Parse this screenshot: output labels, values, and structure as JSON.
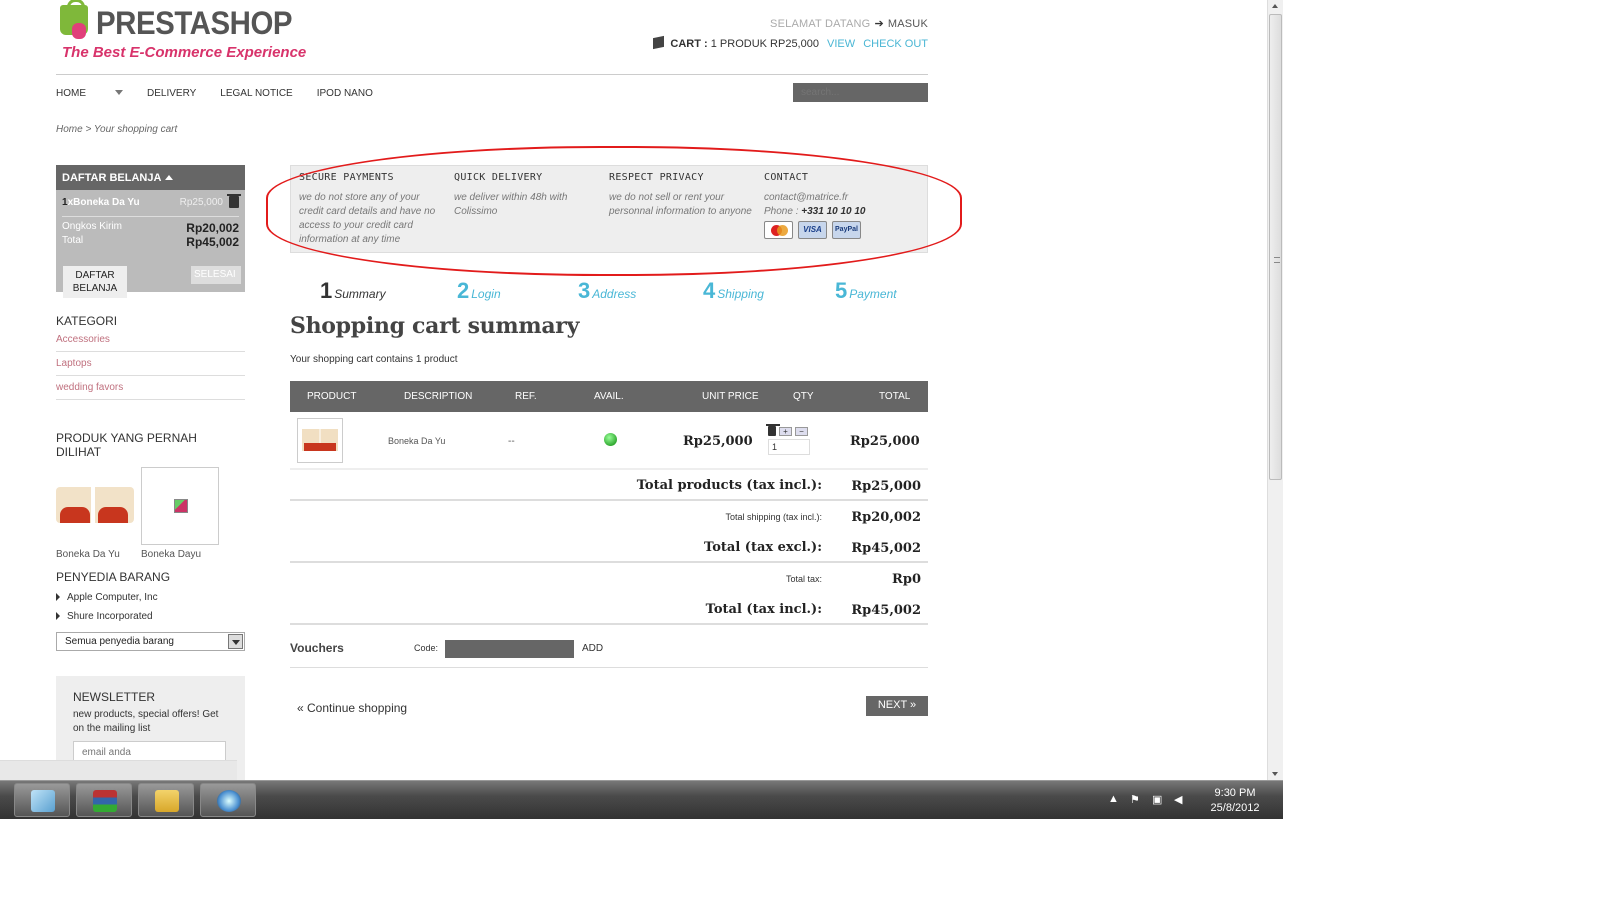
{
  "header": {
    "logo_name": "PRESTASHOP",
    "logo_tagline": "The Best E-Commerce Experience",
    "welcome": "SELAMAT DATANG",
    "login": "MASUK",
    "cart_label": "CART :",
    "cart_summary": "1 PRODUK RP25,000",
    "view": "VIEW",
    "checkout": "CHECK OUT"
  },
  "nav": {
    "items": [
      "HOME",
      "DELIVERY",
      "LEGAL NOTICE",
      "IPOD NANO"
    ],
    "search_placeholder": "search..."
  },
  "breadcrumb": "Home > Your shopping cart",
  "cart_block": {
    "title": "DAFTAR BELANJA",
    "item_qty": "1",
    "item_name": "xBoneka Da Yu",
    "item_price": "Rp25,000",
    "shipping_label": "Ongkos Kirim",
    "shipping_value": "Rp20,002",
    "total_label": "Total",
    "total_value": "Rp45,002",
    "btn_cart": "DAFTAR BELANJA",
    "btn_done": "SELESAI"
  },
  "categories": {
    "title": "KATEGORI",
    "items": [
      "Accessories",
      "Laptops",
      "wedding favors"
    ]
  },
  "viewed": {
    "title": "PRODUK YANG PERNAH DILIHAT",
    "items": [
      "Boneka Da Yu",
      "Boneka Dayu"
    ]
  },
  "suppliers": {
    "title": "PENYEDIA BARANG",
    "items": [
      "Apple Computer, Inc",
      "Shure Incorporated"
    ],
    "select_value": "Semua penyedia barang"
  },
  "newsletter": {
    "title": "NEWSLETTER",
    "desc": "new products, special offers! Get on the mailing list",
    "placeholder": "email anda"
  },
  "reassurance": [
    {
      "title": "SECURE PAYMENTS",
      "text": "we do not store any of your credit card details and have no access to your credit card information at any time"
    },
    {
      "title": "QUICK DELIVERY",
      "text": "we deliver within 48h with Colissimo"
    },
    {
      "title": "RESPECT PRIVACY",
      "text": "we do not sell or rent your personnal information to anyone"
    },
    {
      "title": "CONTACT",
      "email": "contact@matrice.fr",
      "phone_label": "Phone :",
      "phone": "+331 10 10 10",
      "cards": [
        "MC",
        "VISA",
        "PayPal"
      ]
    }
  ],
  "steps": [
    {
      "num": "1",
      "label": "Summary",
      "color": "#333333"
    },
    {
      "num": "2",
      "label": "Login",
      "color": "#49b7d6"
    },
    {
      "num": "3",
      "label": "Address",
      "color": "#49b7d6"
    },
    {
      "num": "4",
      "label": "Shipping",
      "color": "#49b7d6"
    },
    {
      "num": "5",
      "label": "Payment",
      "color": "#49b7d6"
    }
  ],
  "summary": {
    "title": "Shopping cart summary",
    "contains": "Your shopping cart contains 1 product",
    "columns": [
      "PRODUCT",
      "DESCRIPTION",
      "REF.",
      "AVAIL.",
      "UNIT PRICE",
      "QTY",
      "TOTAL"
    ],
    "row": {
      "description": "Boneka Da Yu",
      "ref": "--",
      "unit_price": "Rp25,000",
      "qty": "1",
      "total": "Rp25,000"
    },
    "totals": [
      {
        "label": "Total products (tax incl.):",
        "value": "Rp25,000"
      },
      {
        "label": "Total shipping (tax incl.):",
        "value": "Rp20,002"
      },
      {
        "label": "Total (tax excl.):",
        "value": "Rp45,002"
      },
      {
        "label": "Total tax:",
        "value": "Rp0"
      },
      {
        "label": "Total (tax incl.):",
        "value": "Rp45,002"
      }
    ]
  },
  "vouchers": {
    "title": "Vouchers",
    "code_label": "Code:",
    "add": "ADD"
  },
  "footer_nav": {
    "continue": "« Continue shopping",
    "next": "NEXT »"
  },
  "taskbar": {
    "time": "9:30 PM",
    "date": "25/8/2012"
  },
  "colors": {
    "accent": "#49b7d6",
    "brand_pink": "#d8336b",
    "annotation_red": "#e21b1b"
  }
}
